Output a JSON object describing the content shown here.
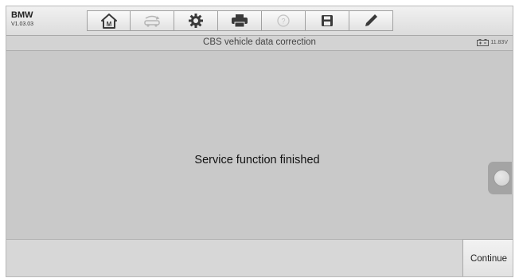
{
  "brand": {
    "name": "BMW",
    "version": "V1.03.03"
  },
  "toolbar": {
    "buttons": [
      {
        "icon": "home-icon",
        "enabled": true
      },
      {
        "icon": "vehicle-swap-icon",
        "enabled": false
      },
      {
        "icon": "gear-icon",
        "enabled": true
      },
      {
        "icon": "printer-icon",
        "enabled": true
      },
      {
        "icon": "help-icon",
        "enabled": false
      },
      {
        "icon": "save-icon",
        "enabled": true
      },
      {
        "icon": "pen-icon",
        "enabled": true
      }
    ]
  },
  "subbar": {
    "title": "CBS vehicle data correction",
    "battery_voltage": "11.83V"
  },
  "main": {
    "message": "Service function finished"
  },
  "footer": {
    "continue_label": "Continue"
  },
  "colors": {
    "background": "#c9c9c9",
    "toolbar": "#e6e6e6",
    "icon": "#3a3a3a",
    "icon_disabled": "#b0b0b0"
  }
}
